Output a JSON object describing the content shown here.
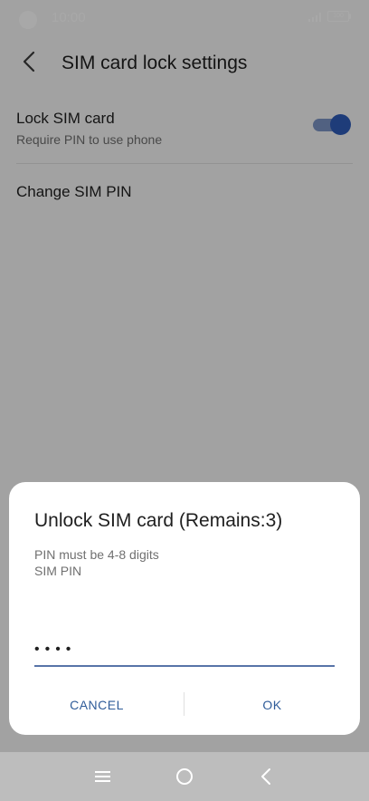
{
  "status_bar": {
    "time": "10:00",
    "battery_level": "100",
    "icons": [
      "camera-cutout-icon",
      "signal-icon",
      "battery-icon"
    ]
  },
  "header": {
    "title": "SIM card lock settings",
    "back_icon": "chevron-left-icon"
  },
  "settings": {
    "lock_sim": {
      "title": "Lock SIM card",
      "subtitle": "Require PIN to use phone",
      "toggle_on": true
    },
    "change_pin": {
      "title": "Change SIM PIN"
    }
  },
  "dialog": {
    "title": "Unlock SIM card (Remains:3)",
    "message_line1": "PIN must be 4-8 digits",
    "message_line2": "SIM PIN",
    "pin_value": "••••",
    "cancel_label": "CANCEL",
    "ok_label": "OK"
  },
  "nav_bar": {
    "icons": [
      "recents-menu-icon",
      "home-circle-icon",
      "back-chevron-icon"
    ]
  },
  "colors": {
    "accent": "#2e5bb8",
    "button_text": "#2f5c99",
    "underline": "#5874a8",
    "toggle_track": "#7b93c4"
  }
}
